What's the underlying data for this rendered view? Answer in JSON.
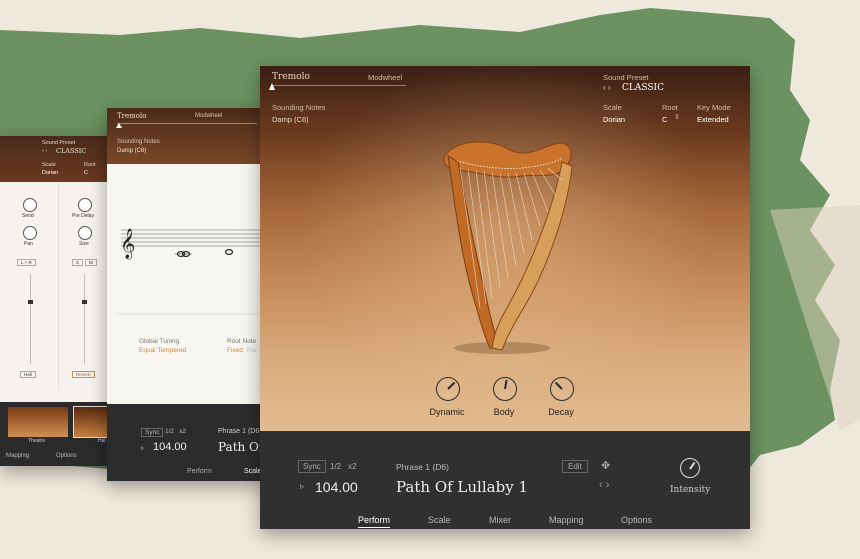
{
  "window_back": {
    "sound_preset_label": "Sound Preset",
    "preset_name": "CLASSIC",
    "scale_label": "Scale",
    "scale_value": "Dorian",
    "root_label": "Root",
    "root_value": "C",
    "send_label": "Send",
    "pre_delay_label": "Pre Delay",
    "pan_label": "Pan",
    "size_label": "Size",
    "pan_value": "L + R",
    "s_label": "S",
    "m_label": "M",
    "hall_label": "Hall",
    "reverb_label": "Reverb",
    "theatre_label": "Theatre",
    "hall2_label": "Hal",
    "mapping_tab": "Mapping",
    "options_tab": "Options"
  },
  "window_mid": {
    "tremolo_label": "Tremolo",
    "modwheel_label": "Modwheel",
    "sounding_notes_label": "Sounding Notes",
    "sounding_notes_value": "Damp (C6)",
    "global_tuning_label": "Global Tuning",
    "global_tuning_value": "Equal Tempered",
    "root_note_label": "Root Note",
    "root_note_value": "Fixed",
    "root_note_extra": "Per",
    "sync_label": "Sync",
    "half_label": "1/2",
    "x2_label": "x2",
    "phrase_label": "Phrase 1 (D6",
    "tempo": "104.00",
    "phrase_name": "Path Of",
    "perform_tab": "Perform",
    "scale_tab": "Scale"
  },
  "window_main": {
    "tremolo_label": "Tremolo",
    "modwheel_label": "Modwheel",
    "sounding_notes_label": "Sounding Notes",
    "sounding_notes_value": "Damp (C6)",
    "sound_preset_label": "Sound Preset",
    "preset_name": "CLASSIC",
    "scale_label": "Scale",
    "scale_value": "Dorian",
    "root_label": "Root",
    "root_value": "C",
    "key_mode_label": "Key Mode",
    "key_mode_value": "Extended",
    "knobs": [
      {
        "label": "Dynamic",
        "value": 0.7
      },
      {
        "label": "Body",
        "value": 0.55
      },
      {
        "label": "Decay",
        "value": 0.3
      }
    ],
    "sync_label": "Sync",
    "half_label": "1/2",
    "x2_label": "x2",
    "phrase_label": "Phrase 1 (D6)",
    "edit_label": "Edit",
    "tempo": "104.00",
    "phrase_name": "Path Of Lullaby 1",
    "intensity_label": "Intensity",
    "tabs": [
      "Perform",
      "Scale",
      "Mixer",
      "Mapping",
      "Options"
    ],
    "active_tab": "Perform"
  },
  "colors": {
    "green_paper": "#5f8a55",
    "wood_accent": "#c9732c",
    "orange_text": "#c98a3a"
  }
}
